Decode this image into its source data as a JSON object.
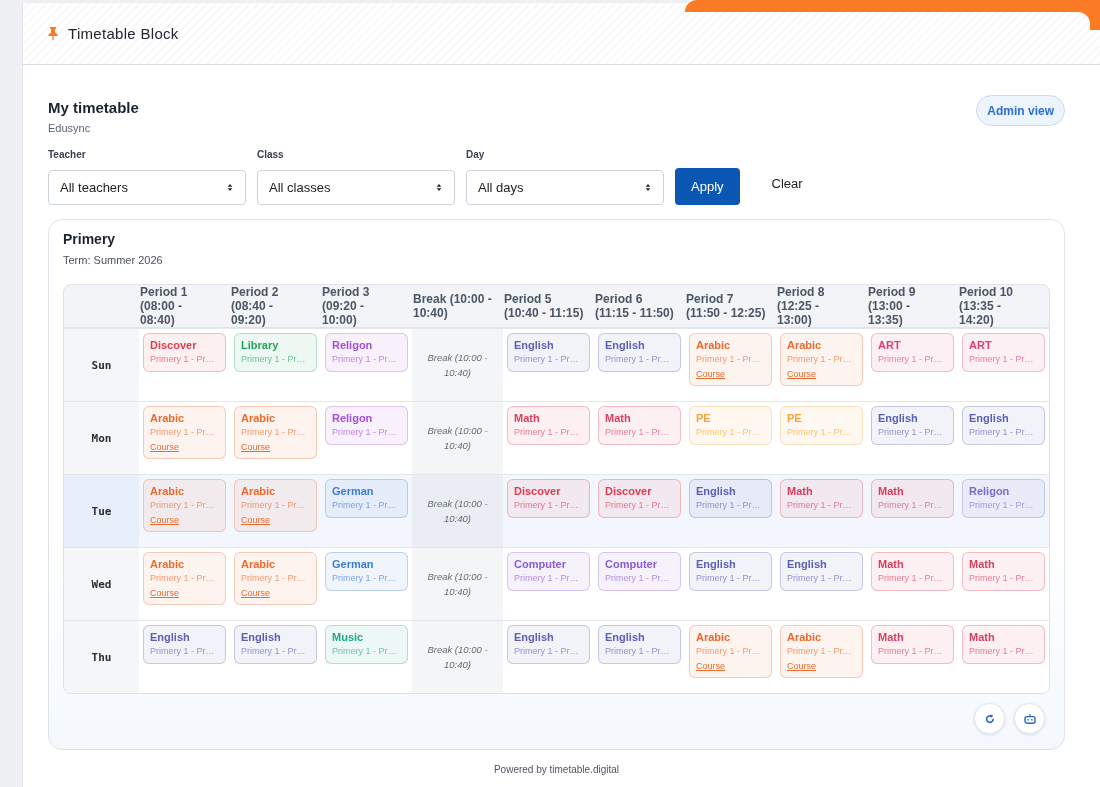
{
  "header": {
    "title": "Timetable Block"
  },
  "page": {
    "title": "My timetable",
    "subtitle": "Edusync",
    "admin_button": "Admin view"
  },
  "filters": [
    {
      "label": "Teacher",
      "value": "All teachers"
    },
    {
      "label": "Class",
      "value": "All classes"
    },
    {
      "label": "Day",
      "value": "All days"
    }
  ],
  "buttons": [
    {
      "label": "Apply",
      "kind": "primary"
    },
    {
      "label": "Clear",
      "kind": "plain"
    }
  ],
  "timetable": {
    "title": "Primery",
    "term": "Term: Summer 2026",
    "columns": [
      "Period 1 (08:00 - 08:40)",
      "Period 2 (08:40 - 09:20)",
      "Period 3 (09:20 - 10:00)",
      "Break (10:00 - 10:40)",
      "Period 5 (10:40 - 11:15)",
      "Period 6 (11:15 - 11:50)",
      "Period 7 (11:50 - 12:25)",
      "Period 8 (12:25 - 13:00)",
      "Period 9 (13:00 - 13:35)",
      "Period 10 (13:35 - 14:20)"
    ],
    "rows": [
      {
        "day": "Sun",
        "highlighted": false,
        "cells": [
          {
            "kind": "lesson",
            "subject": "Discover",
            "group": "Primery 1 - Pr…",
            "color": "#e23b50"
          },
          {
            "kind": "lesson",
            "subject": "Library",
            "group": "Primery 1 - Pr…",
            "color": "#22a45d"
          },
          {
            "kind": "lesson",
            "subject": "Religon",
            "group": "Primery 1 - Pr…",
            "color": "#a24fd9"
          },
          {
            "kind": "break",
            "text": "Break (10:00 - 10:40)"
          },
          {
            "kind": "lesson",
            "subject": "English",
            "group": "Primery 1 - Pr…",
            "color": "#5b5fb8"
          },
          {
            "kind": "lesson",
            "subject": "English",
            "group": "Primery 1 - Pr…",
            "color": "#5b5fb8"
          },
          {
            "kind": "lesson",
            "subject": "Arabic",
            "group": "Primery 1 - Pr…",
            "color": "#eb6a2e",
            "link": "Course"
          },
          {
            "kind": "lesson",
            "subject": "Arabic",
            "group": "Primery 1 - Pr…",
            "color": "#eb6a2e",
            "link": "Course"
          },
          {
            "kind": "lesson",
            "subject": "ART",
            "group": "Primery 1 - Pr…",
            "color": "#dd3f74"
          },
          {
            "kind": "lesson",
            "subject": "ART",
            "group": "Primery 1 - Pr…",
            "color": "#dd3f74"
          }
        ]
      },
      {
        "day": "Mon",
        "highlighted": false,
        "cells": [
          {
            "kind": "lesson",
            "subject": "Arabic",
            "group": "Primery 1 - Pr…",
            "color": "#eb6a2e",
            "link": "Course"
          },
          {
            "kind": "lesson",
            "subject": "Arabic",
            "group": "Primery 1 - Pr…",
            "color": "#eb6a2e",
            "link": "Course"
          },
          {
            "kind": "lesson",
            "subject": "Religon",
            "group": "Primery 1 - Pr…",
            "color": "#a24fd9"
          },
          {
            "kind": "break",
            "text": "Break (10:00 - 10:40)"
          },
          {
            "kind": "lesson",
            "subject": "Math",
            "group": "Primery 1 - Pr…",
            "color": "#d9405f"
          },
          {
            "kind": "lesson",
            "subject": "Math",
            "group": "Primery 1 - Pr…",
            "color": "#d9405f"
          },
          {
            "kind": "lesson",
            "subject": "PE",
            "group": "Primery 1 - Pr…",
            "color": "#f2a440"
          },
          {
            "kind": "lesson",
            "subject": "PE",
            "group": "Primery 1 - Pr…",
            "color": "#f2a440"
          },
          {
            "kind": "lesson",
            "subject": "English",
            "group": "Primery 1 - Pr…",
            "color": "#5b5fb8"
          },
          {
            "kind": "lesson",
            "subject": "English",
            "group": "Primery 1 - Pr…",
            "color": "#5b5fb8"
          }
        ]
      },
      {
        "day": "Tue",
        "highlighted": true,
        "cells": [
          {
            "kind": "lesson",
            "subject": "Arabic",
            "group": "Primery 1 - Pr…",
            "color": "#eb6a2e",
            "link": "Course"
          },
          {
            "kind": "lesson",
            "subject": "Arabic",
            "group": "Primery 1 - Pr…",
            "color": "#eb6a2e",
            "link": "Course"
          },
          {
            "kind": "lesson",
            "subject": "German",
            "group": "Primery 1 - Pr…",
            "color": "#3b7bd9"
          },
          {
            "kind": "break",
            "text": "Break (10:00 - 10:40)"
          },
          {
            "kind": "lesson",
            "subject": "Discover",
            "group": "Primery 1 - Pr…",
            "color": "#e23b50"
          },
          {
            "kind": "lesson",
            "subject": "Discover",
            "group": "Primery 1 - Pr…",
            "color": "#e23b50"
          },
          {
            "kind": "lesson",
            "subject": "English",
            "group": "Primery 1 - Pr…",
            "color": "#5b5fb8"
          },
          {
            "kind": "lesson",
            "subject": "Math",
            "group": "Primery 1 - Pr…",
            "color": "#d9405f"
          },
          {
            "kind": "lesson",
            "subject": "Math",
            "group": "Primery 1 - Pr…",
            "color": "#d9405f"
          },
          {
            "kind": "lesson",
            "subject": "Religon",
            "group": "Primery 1 - Pr…",
            "color": "#7b6acd"
          }
        ]
      },
      {
        "day": "Wed",
        "highlighted": false,
        "cells": [
          {
            "kind": "lesson",
            "subject": "Arabic",
            "group": "Primery 1 - Pr…",
            "color": "#eb6a2e",
            "link": "Course"
          },
          {
            "kind": "lesson",
            "subject": "Arabic",
            "group": "Primery 1 - Pr…",
            "color": "#eb6a2e",
            "link": "Course"
          },
          {
            "kind": "lesson",
            "subject": "German",
            "group": "Primery 1 - Pr…",
            "color": "#3b7bd9"
          },
          {
            "kind": "break",
            "text": "Break (10:00 - 10:40)"
          },
          {
            "kind": "lesson",
            "subject": "Computer",
            "group": "Primery 1 - Pr…",
            "color": "#8a5bd6"
          },
          {
            "kind": "lesson",
            "subject": "Computer",
            "group": "Primery 1 - Pr…",
            "color": "#8a5bd6"
          },
          {
            "kind": "lesson",
            "subject": "English",
            "group": "Primery 1 - Pr…",
            "color": "#5b5fb8"
          },
          {
            "kind": "lesson",
            "subject": "English",
            "group": "Primery 1 - Pr…",
            "color": "#5b5fb8"
          },
          {
            "kind": "lesson",
            "subject": "Math",
            "group": "Primery 1 - Pr…",
            "color": "#d9405f"
          },
          {
            "kind": "lesson",
            "subject": "Math",
            "group": "Primery 1 - Pr…",
            "color": "#d9405f"
          }
        ]
      },
      {
        "day": "Thu",
        "highlighted": false,
        "cells": [
          {
            "kind": "lesson",
            "subject": "English",
            "group": "Primery 1 - Pr…",
            "color": "#5b5fb8"
          },
          {
            "kind": "lesson",
            "subject": "English",
            "group": "Primery 1 - Pr…",
            "color": "#5b5fb8"
          },
          {
            "kind": "lesson",
            "subject": "Music",
            "group": "Primery 1 - Pr…",
            "color": "#1ea98b"
          },
          {
            "kind": "break",
            "text": "Break (10:00 - 10:40)"
          },
          {
            "kind": "lesson",
            "subject": "English",
            "group": "Primery 1 - Pr…",
            "color": "#5b5fb8"
          },
          {
            "kind": "lesson",
            "subject": "English",
            "group": "Primery 1 - Pr…",
            "color": "#5b5fb8"
          },
          {
            "kind": "lesson",
            "subject": "Arabic",
            "group": "Primery 1 - Pr…",
            "color": "#eb6a2e",
            "link": "Course"
          },
          {
            "kind": "lesson",
            "subject": "Arabic",
            "group": "Primery 1 - Pr…",
            "color": "#eb6a2e",
            "link": "Course"
          },
          {
            "kind": "lesson",
            "subject": "Math",
            "group": "Primery 1 - Pr…",
            "color": "#d9405f"
          },
          {
            "kind": "lesson",
            "subject": "Math",
            "group": "Primery 1 - Pr…",
            "color": "#d9405f"
          }
        ]
      }
    ]
  },
  "footer": "Powered by timetable.digital"
}
